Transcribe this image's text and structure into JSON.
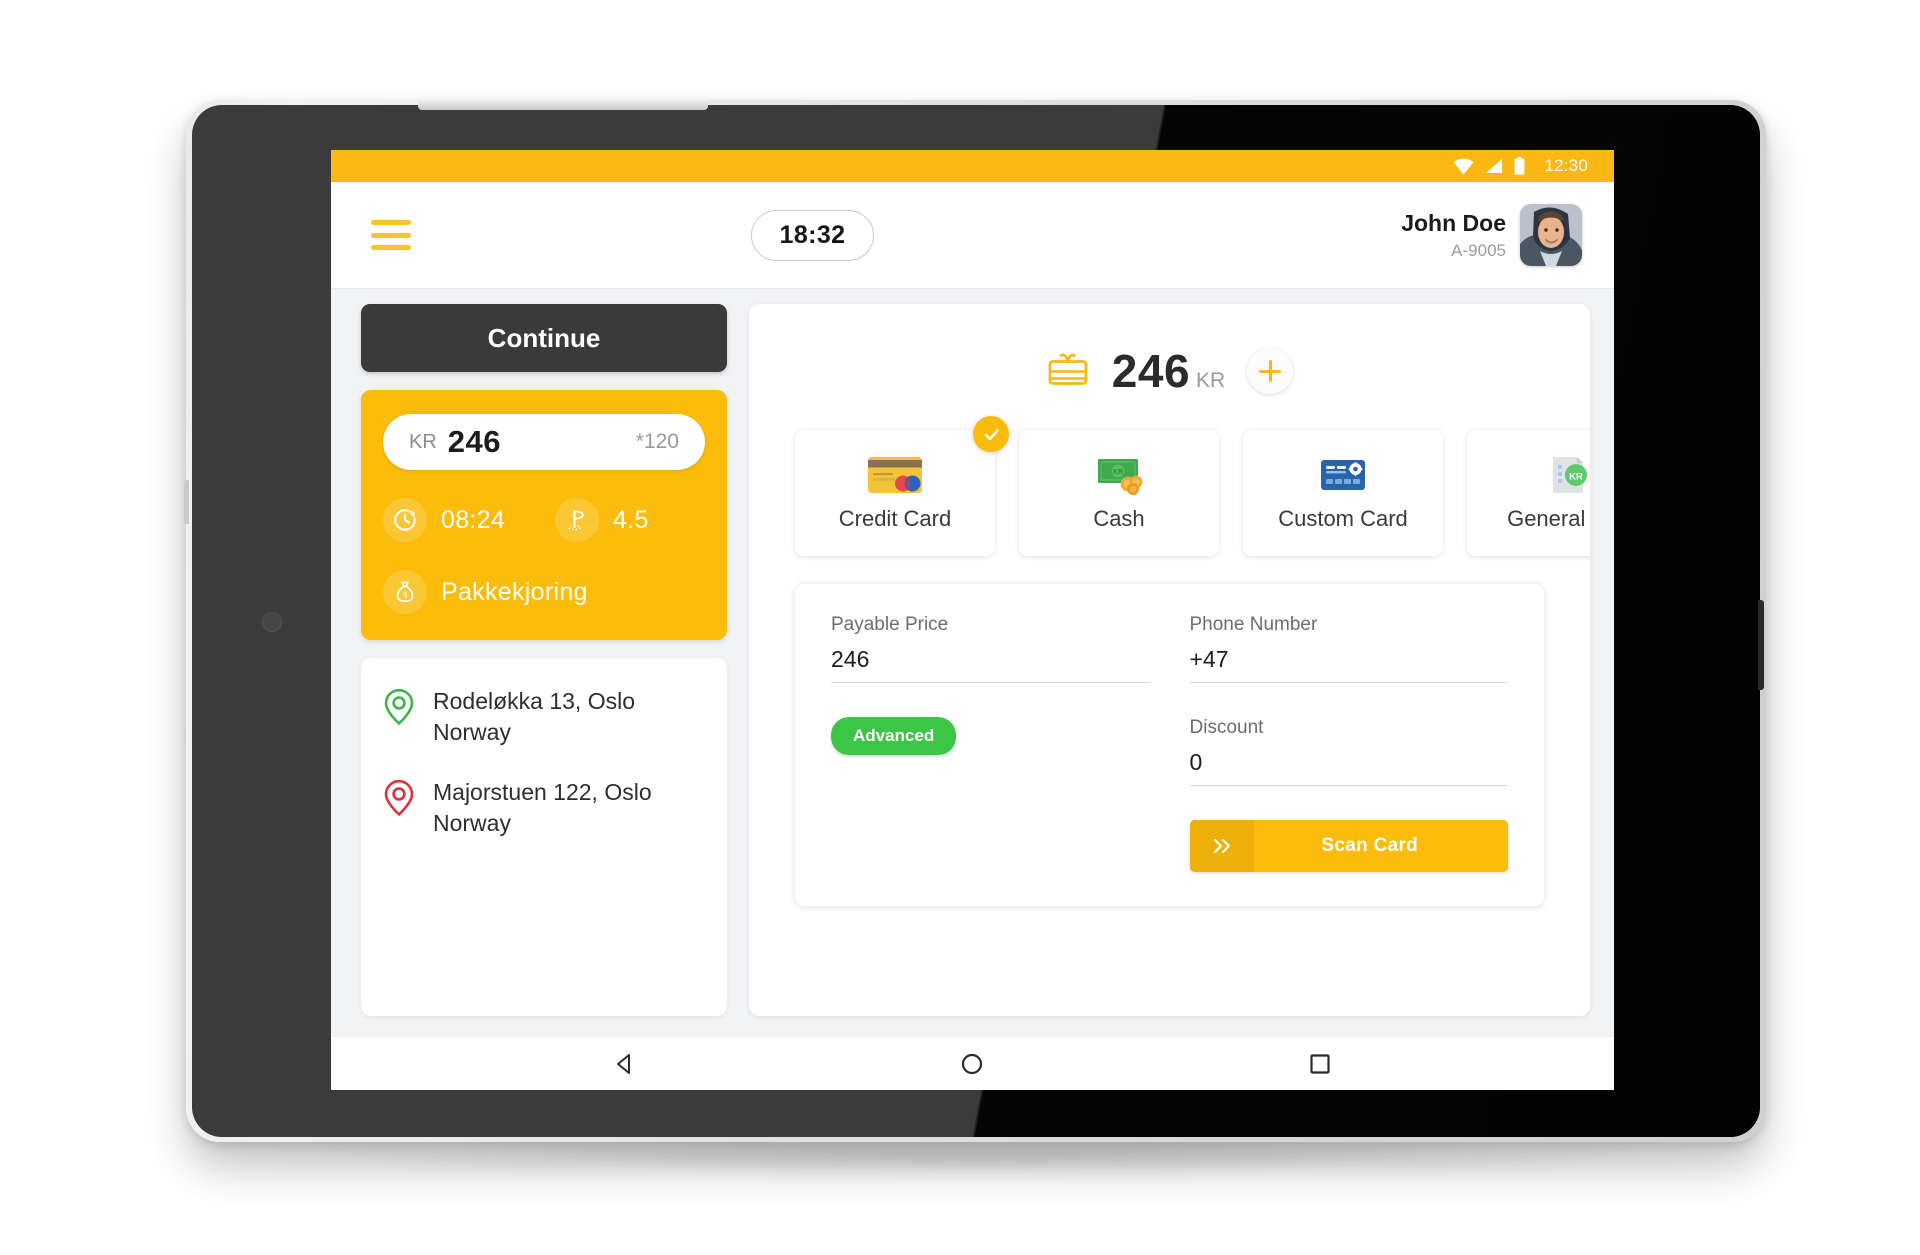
{
  "status_bar": {
    "time": "12:30",
    "icons": [
      "wifi-icon",
      "signal-icon",
      "battery-icon"
    ],
    "background": "#FBB713"
  },
  "header": {
    "menu_icon": "hamburger-menu-icon",
    "trip_time": "18:32",
    "user_name": "John Doe",
    "user_id": "A-9005",
    "avatar": "driver-avatar"
  },
  "sidebar": {
    "continue_label": "Continue",
    "trip_card": {
      "currency": "KR",
      "fare": "246",
      "fare_meta": "*120",
      "duration": "08:24",
      "distance": "4.5",
      "service_type": "Pakkekjoring",
      "background": "#FBBC0B"
    },
    "addresses": [
      {
        "icon": "pickup-pin-icon",
        "color": "#3CB64A",
        "line1": "Rodeløkka 13, Oslo",
        "line2": "Norway"
      },
      {
        "icon": "dropoff-pin-icon",
        "color": "#D8343C",
        "line1": "Majorstuen 122, Oslo",
        "line2": "Norway"
      }
    ]
  },
  "main": {
    "total": {
      "icon": "ticket-gift-icon",
      "amount": "246",
      "currency": "KR",
      "add_icon": "plus-icon"
    },
    "payment_methods": [
      {
        "label": "Credit Card",
        "icon": "credit-card-icon",
        "selected": true
      },
      {
        "label": "Cash",
        "icon": "cash-money-icon",
        "selected": false
      },
      {
        "label": "Custom Card",
        "icon": "custom-card-icon",
        "selected": false
      },
      {
        "label": "General Cre",
        "icon": "general-credit-icon",
        "selected": false
      }
    ],
    "form": {
      "payable_price_label": "Payable Price",
      "payable_price_value": "246",
      "phone_label": "Phone Number",
      "phone_value": "+47",
      "discount_label": "Discount",
      "discount_value": "0",
      "advanced_label": "Advanced",
      "advanced_color": "#3CC646",
      "scan_label": "Scan Card",
      "scan_icon": "double-chevron-right-icon"
    }
  },
  "nav_bar": {
    "back": "back-triangle-icon",
    "home": "home-circle-icon",
    "recents": "recents-square-icon"
  }
}
